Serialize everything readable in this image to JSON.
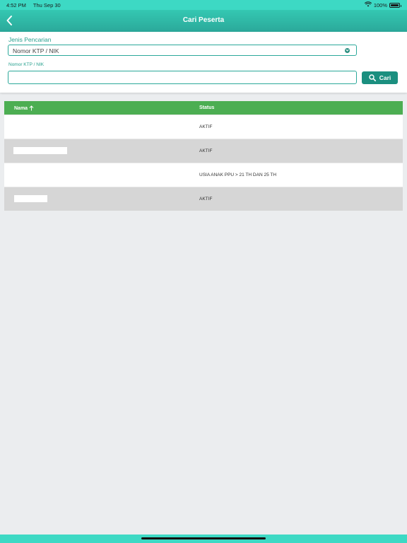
{
  "status_bar": {
    "time": "4:52 PM",
    "date": "Thu Sep 30",
    "battery": "100%"
  },
  "header": {
    "title": "Cari Peserta"
  },
  "form": {
    "search_type_label": "Jenis Pencarian",
    "search_type_value": "Nomor KTP / NIK",
    "id_label": "Nomor KTP / NIK",
    "id_value": "",
    "search_button": "Cari"
  },
  "table": {
    "columns": [
      "Nama",
      "Status"
    ],
    "rows": [
      {
        "nama": "",
        "status": "AKTIF"
      },
      {
        "nama": "",
        "status": "AKTIF"
      },
      {
        "nama": "",
        "status": "USIA ANAK PPU > 21 TH DAN 25 TH"
      },
      {
        "nama": "",
        "status": "AKTIF"
      }
    ]
  },
  "colors": {
    "header": "#2ba89a",
    "accent": "#1b8f7f",
    "table_header": "#4cae52"
  }
}
